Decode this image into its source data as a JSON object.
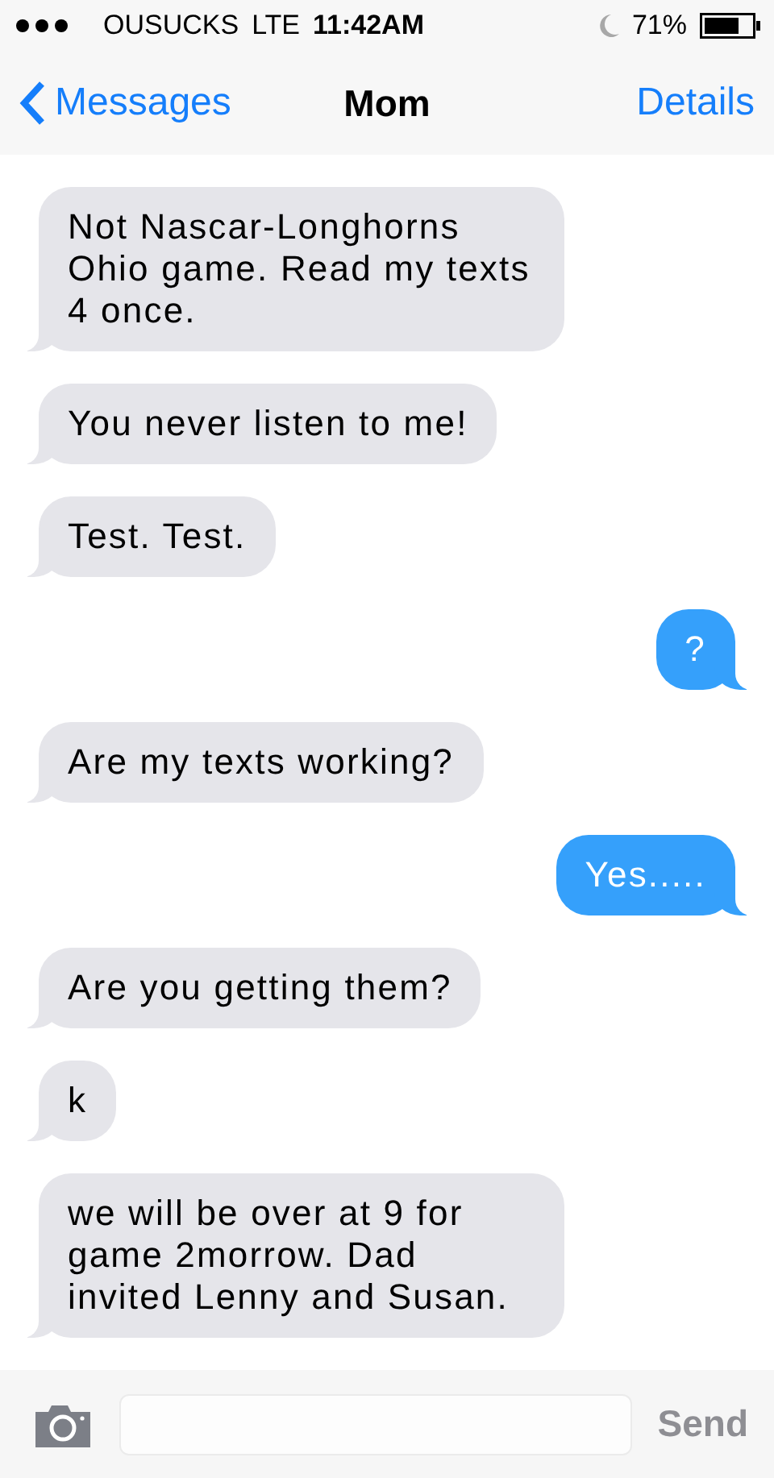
{
  "status_bar": {
    "carrier": "OUSUCKS",
    "network": "LTE",
    "time": "11:42AM",
    "battery": "71%"
  },
  "nav": {
    "back": "Messages",
    "title": "Mom",
    "action": "Details"
  },
  "messages": [
    {
      "kind": "received",
      "text": "Not Nascar-Longhorns Ohio game. Read my texts 4 once."
    },
    {
      "kind": "received",
      "text": "You never listen to me!"
    },
    {
      "kind": "received",
      "text": "Test. Test."
    },
    {
      "kind": "sent",
      "text": "?"
    },
    {
      "kind": "received",
      "text": "Are my texts working?"
    },
    {
      "kind": "sent",
      "text": "Yes....."
    },
    {
      "kind": "received",
      "text": "Are you getting them?"
    },
    {
      "kind": "received",
      "text": "k"
    },
    {
      "kind": "received",
      "text": "we will be over at 9 for game 2morrow. Dad invited Lenny and Susan."
    }
  ],
  "composer": {
    "send": {
      "label": "Send",
      "disabled": true
    }
  }
}
